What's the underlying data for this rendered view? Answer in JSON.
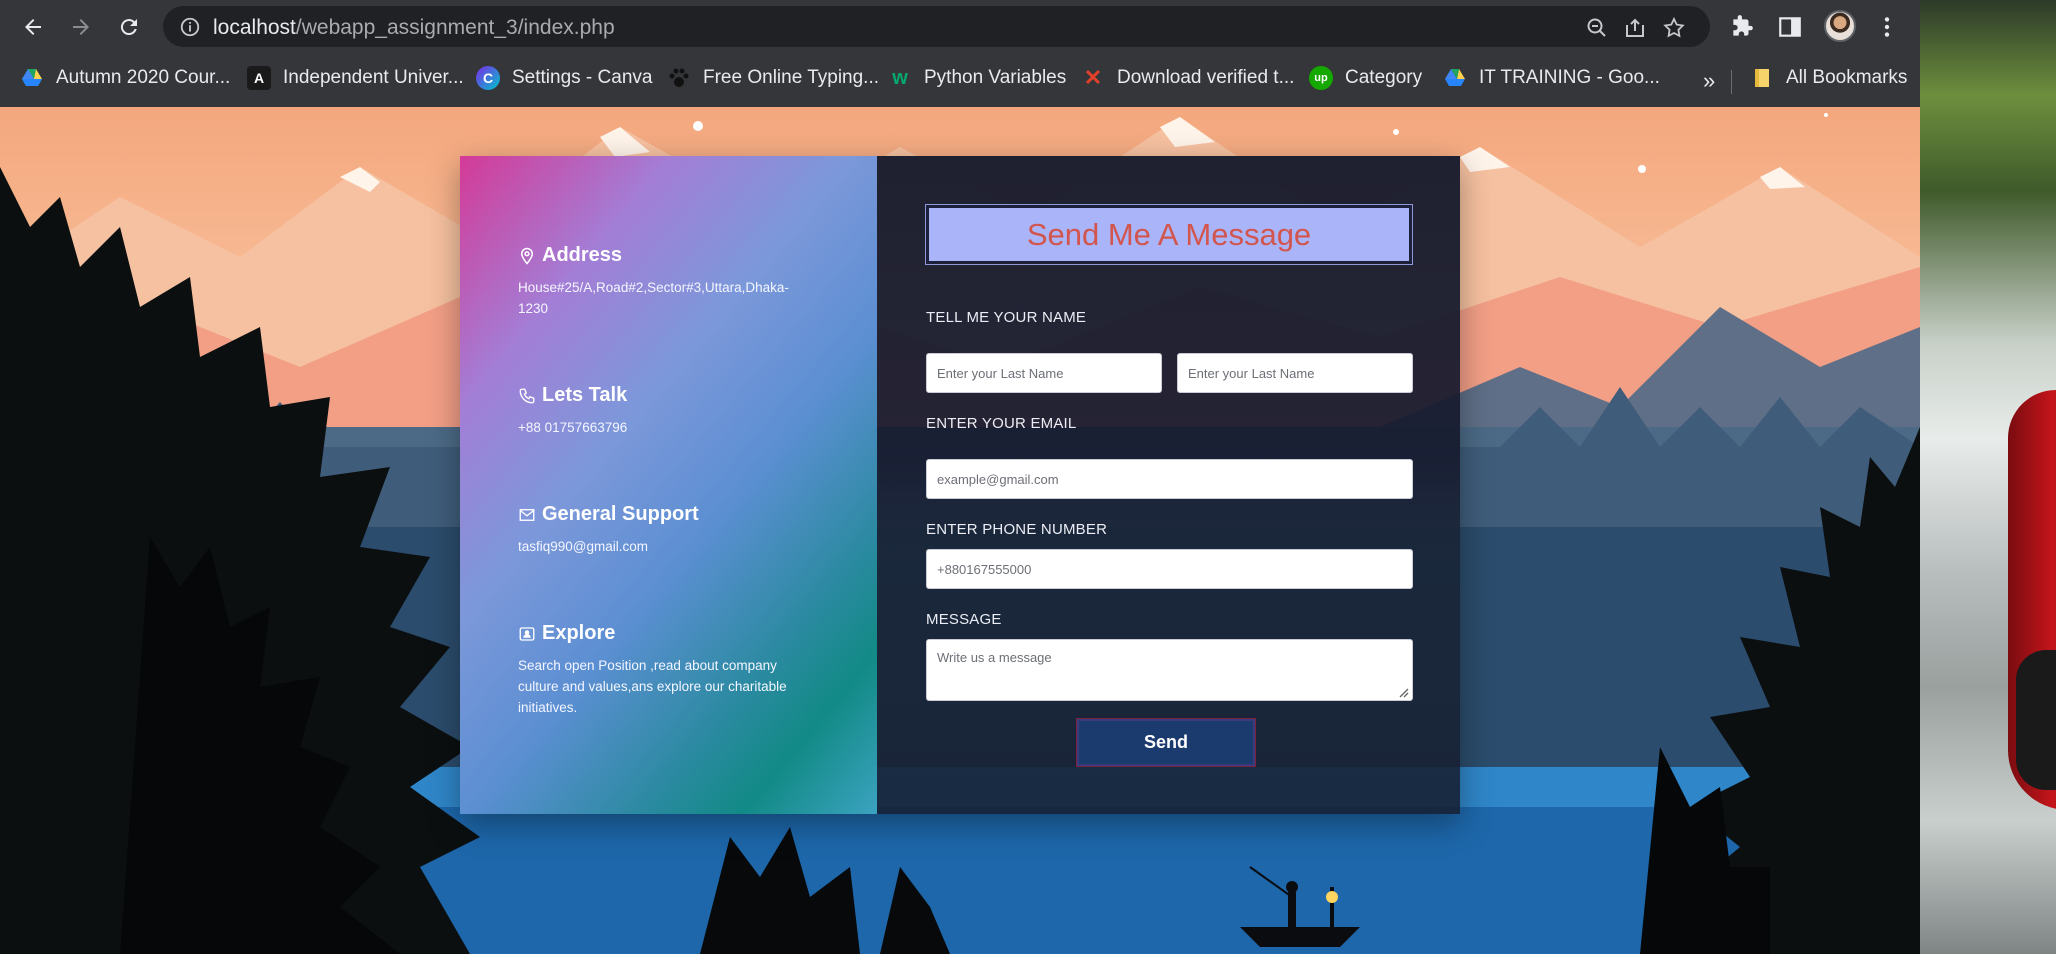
{
  "browser": {
    "url_host": "localhost",
    "url_path": "/webapp_assignment_3/index.php",
    "bookmarks": [
      {
        "label": "Autumn 2020 Cour...",
        "icon": "google-drive-icon"
      },
      {
        "label": "Independent Univer...",
        "icon": "angular-icon"
      },
      {
        "label": "Settings - Canva",
        "icon": "canva-icon"
      },
      {
        "label": "Free Online Typing...",
        "icon": "paw-icon"
      },
      {
        "label": "Python Variables",
        "icon": "w3schools-icon"
      },
      {
        "label": "Download verified t...",
        "icon": "x-icon"
      },
      {
        "label": "Category",
        "icon": "upwork-icon"
      },
      {
        "label": "IT TRAINING - Goo...",
        "icon": "google-drive-icon"
      }
    ],
    "more": "»",
    "all_bookmarks": "All Bookmarks"
  },
  "contact_info": {
    "address": {
      "title": "Address",
      "text": "House#25/A,Road#2,Sector#3,Uttara,Dhaka-1230"
    },
    "talk": {
      "title": "Lets Talk",
      "text": "+88 01757663796"
    },
    "support": {
      "title": "General Support",
      "text": "tasfiq990@gmail.com"
    },
    "explore": {
      "title": "Explore",
      "text": "Search open Position ,read about company culture and values,ans explore our charitable initiatives."
    }
  },
  "form": {
    "heading": "Send Me A Message",
    "name_label": "TELL ME YOUR NAME",
    "first_name_placeholder": "Enter your Last Name",
    "last_name_placeholder": "Enter your Last Name",
    "email_label": "ENTER YOUR EMAIL",
    "email_placeholder": "example@gmail.com",
    "phone_label": "ENTER PHONE NUMBER",
    "phone_placeholder": "+880167555000",
    "message_label": "MESSAGE",
    "message_placeholder": "Write us a message",
    "send_label": "Send"
  },
  "colors": {
    "heading_bg": "#aab4f8",
    "heading_text": "#d2554e",
    "send_bg": "#1b3b6f",
    "chrome_bg": "#35363a"
  }
}
